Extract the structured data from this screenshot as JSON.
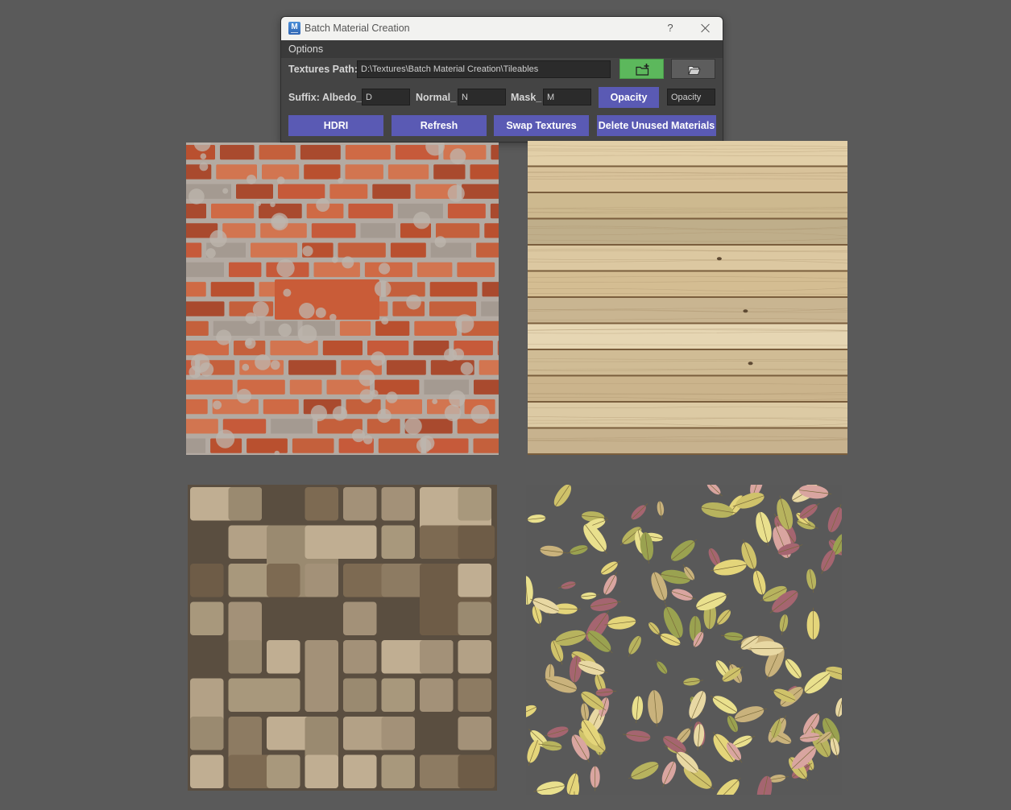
{
  "window": {
    "title": "Batch Material Creation",
    "help_glyph": "?",
    "icon": "maya-app-icon",
    "icon_letter": "M"
  },
  "menu": {
    "options_label": "Options"
  },
  "path_row": {
    "label": "Textures Path:",
    "value": "D:\\Textures\\Batch Material Creation\\Tileables",
    "add_button_icon": "new-folder-plus-icon",
    "browse_button_icon": "folder-open-icon"
  },
  "suffix_row": {
    "label": "Suffix:",
    "albedo_label": "Albedo_",
    "albedo_value": "D",
    "normal_label": "Normal_",
    "normal_value": "N",
    "mask_label": "Mask_",
    "mask_value": "M",
    "opacity_button": "Opacity",
    "opacity_value": "Opacity"
  },
  "actions": {
    "hdri": "HDRI",
    "refresh": "Refresh",
    "swap": "Swap Textures",
    "delete": "Delete Unused Materials"
  },
  "colors": {
    "background": "#5a5a5a",
    "dialog_bg": "#444444",
    "button_accent": "#5a5ab4",
    "add_button": "#5cb85c"
  },
  "textures": [
    "red-brick-wall",
    "light-wood-planks",
    "stone-block-floor",
    "autumn-leaves-scatter"
  ]
}
